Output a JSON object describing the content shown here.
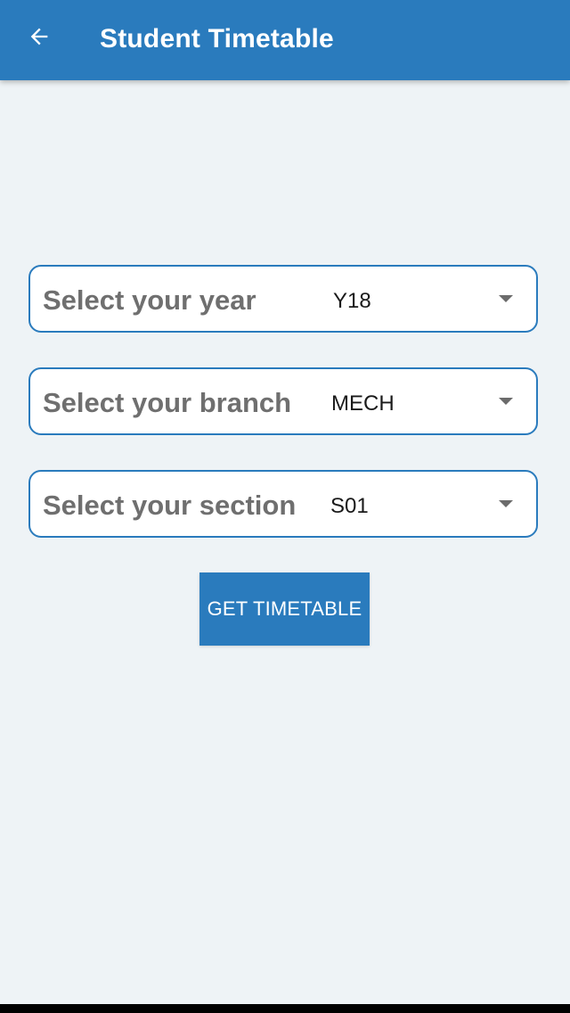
{
  "app_bar": {
    "title": "Student Timetable",
    "back_icon": "arrow-back-icon"
  },
  "form": {
    "year": {
      "label": "Select your year",
      "value": "Y18",
      "icon": "dropdown-arrow-icon"
    },
    "branch": {
      "label": "Select your branch",
      "value": "MECH",
      "icon": "dropdown-arrow-icon"
    },
    "section": {
      "label": "Select your section",
      "value": "S01",
      "icon": "dropdown-arrow-icon"
    },
    "submit_label": "GET TIMETABLE"
  },
  "colors": {
    "primary": "#2a7bbd",
    "background": "#eef3f6",
    "label_text": "#6f6f6f",
    "value_text": "#1a1a1a"
  }
}
